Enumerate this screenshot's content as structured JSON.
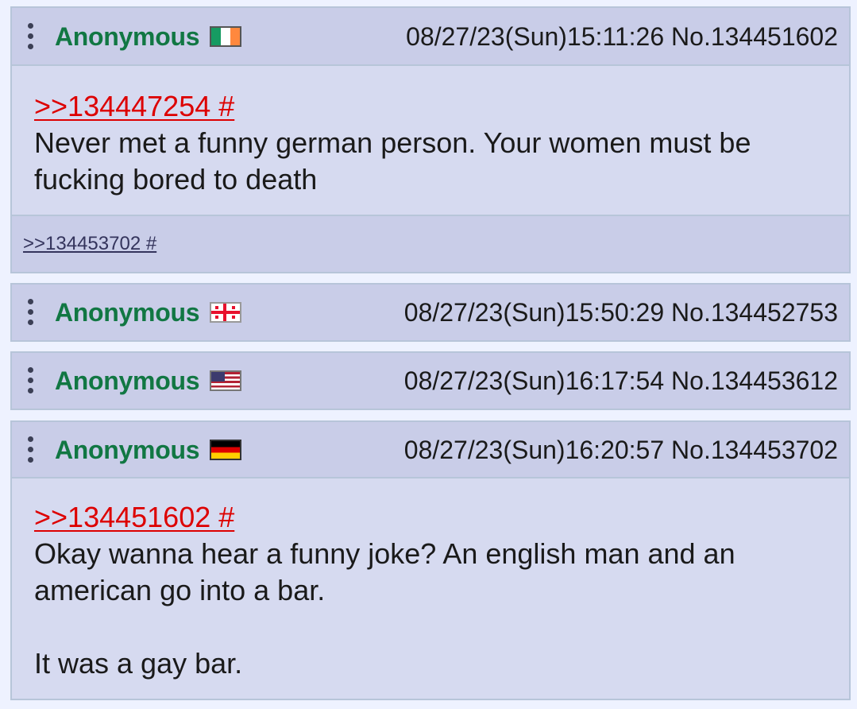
{
  "posts": [
    {
      "name": "Anonymous",
      "flag_icon": "ireland-flag-icon",
      "datetime": "08/27/23(Sun)15:11:26",
      "number_label": "No.134451602",
      "quote_link": ">>134447254 #",
      "message_lines": [
        "Never met a funny german person. Your women must be",
        "fucking bored to death"
      ],
      "replies": [
        ">>134453702 #"
      ]
    },
    {
      "name": "Anonymous",
      "flag_icon": "georgia-flag-icon",
      "datetime": "08/27/23(Sun)15:50:29",
      "number_label": "No.134452753"
    },
    {
      "name": "Anonymous",
      "flag_icon": "usa-flag-icon",
      "datetime": "08/27/23(Sun)16:17:54",
      "number_label": "No.134453612"
    },
    {
      "name": "Anonymous",
      "flag_icon": "germany-flag-icon",
      "datetime": "08/27/23(Sun)16:20:57",
      "number_label": "No.134453702",
      "quote_link": ">>134451602 #",
      "message_lines": [
        "Okay wanna hear a funny joke? An english man and an",
        "american go into a bar.",
        "",
        "It was a gay bar."
      ]
    }
  ],
  "colors": {
    "page_background": "#eef2ff",
    "post_background": "#d6daf0",
    "header_background": "#c9cde8",
    "border": "#b7c5d9",
    "name": "#117743",
    "quote_link": "#dd0000",
    "reply_link": "#34345c"
  }
}
